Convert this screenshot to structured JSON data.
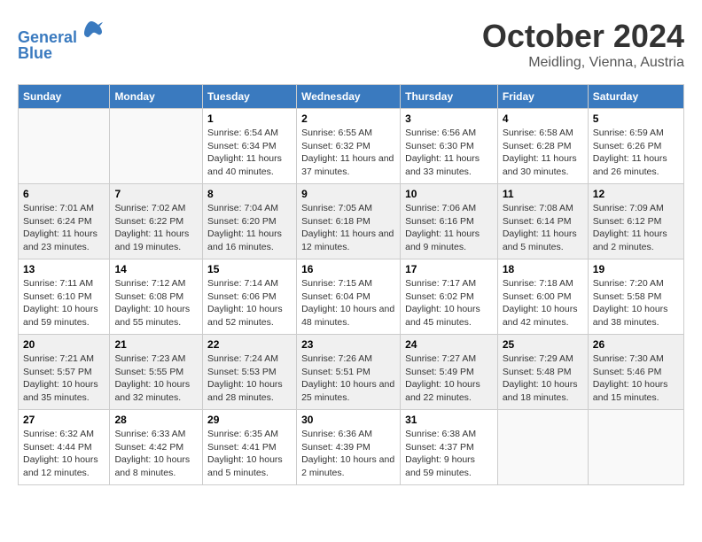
{
  "header": {
    "logo_line1": "General",
    "logo_line2": "Blue",
    "month": "October 2024",
    "location": "Meidling, Vienna, Austria"
  },
  "weekdays": [
    "Sunday",
    "Monday",
    "Tuesday",
    "Wednesday",
    "Thursday",
    "Friday",
    "Saturday"
  ],
  "weeks": [
    [
      {
        "day": "",
        "info": ""
      },
      {
        "day": "",
        "info": ""
      },
      {
        "day": "1",
        "info": "Sunrise: 6:54 AM\nSunset: 6:34 PM\nDaylight: 11 hours and 40 minutes."
      },
      {
        "day": "2",
        "info": "Sunrise: 6:55 AM\nSunset: 6:32 PM\nDaylight: 11 hours and 37 minutes."
      },
      {
        "day": "3",
        "info": "Sunrise: 6:56 AM\nSunset: 6:30 PM\nDaylight: 11 hours and 33 minutes."
      },
      {
        "day": "4",
        "info": "Sunrise: 6:58 AM\nSunset: 6:28 PM\nDaylight: 11 hours and 30 minutes."
      },
      {
        "day": "5",
        "info": "Sunrise: 6:59 AM\nSunset: 6:26 PM\nDaylight: 11 hours and 26 minutes."
      }
    ],
    [
      {
        "day": "6",
        "info": "Sunrise: 7:01 AM\nSunset: 6:24 PM\nDaylight: 11 hours and 23 minutes."
      },
      {
        "day": "7",
        "info": "Sunrise: 7:02 AM\nSunset: 6:22 PM\nDaylight: 11 hours and 19 minutes."
      },
      {
        "day": "8",
        "info": "Sunrise: 7:04 AM\nSunset: 6:20 PM\nDaylight: 11 hours and 16 minutes."
      },
      {
        "day": "9",
        "info": "Sunrise: 7:05 AM\nSunset: 6:18 PM\nDaylight: 11 hours and 12 minutes."
      },
      {
        "day": "10",
        "info": "Sunrise: 7:06 AM\nSunset: 6:16 PM\nDaylight: 11 hours and 9 minutes."
      },
      {
        "day": "11",
        "info": "Sunrise: 7:08 AM\nSunset: 6:14 PM\nDaylight: 11 hours and 5 minutes."
      },
      {
        "day": "12",
        "info": "Sunrise: 7:09 AM\nSunset: 6:12 PM\nDaylight: 11 hours and 2 minutes."
      }
    ],
    [
      {
        "day": "13",
        "info": "Sunrise: 7:11 AM\nSunset: 6:10 PM\nDaylight: 10 hours and 59 minutes."
      },
      {
        "day": "14",
        "info": "Sunrise: 7:12 AM\nSunset: 6:08 PM\nDaylight: 10 hours and 55 minutes."
      },
      {
        "day": "15",
        "info": "Sunrise: 7:14 AM\nSunset: 6:06 PM\nDaylight: 10 hours and 52 minutes."
      },
      {
        "day": "16",
        "info": "Sunrise: 7:15 AM\nSunset: 6:04 PM\nDaylight: 10 hours and 48 minutes."
      },
      {
        "day": "17",
        "info": "Sunrise: 7:17 AM\nSunset: 6:02 PM\nDaylight: 10 hours and 45 minutes."
      },
      {
        "day": "18",
        "info": "Sunrise: 7:18 AM\nSunset: 6:00 PM\nDaylight: 10 hours and 42 minutes."
      },
      {
        "day": "19",
        "info": "Sunrise: 7:20 AM\nSunset: 5:58 PM\nDaylight: 10 hours and 38 minutes."
      }
    ],
    [
      {
        "day": "20",
        "info": "Sunrise: 7:21 AM\nSunset: 5:57 PM\nDaylight: 10 hours and 35 minutes."
      },
      {
        "day": "21",
        "info": "Sunrise: 7:23 AM\nSunset: 5:55 PM\nDaylight: 10 hours and 32 minutes."
      },
      {
        "day": "22",
        "info": "Sunrise: 7:24 AM\nSunset: 5:53 PM\nDaylight: 10 hours and 28 minutes."
      },
      {
        "day": "23",
        "info": "Sunrise: 7:26 AM\nSunset: 5:51 PM\nDaylight: 10 hours and 25 minutes."
      },
      {
        "day": "24",
        "info": "Sunrise: 7:27 AM\nSunset: 5:49 PM\nDaylight: 10 hours and 22 minutes."
      },
      {
        "day": "25",
        "info": "Sunrise: 7:29 AM\nSunset: 5:48 PM\nDaylight: 10 hours and 18 minutes."
      },
      {
        "day": "26",
        "info": "Sunrise: 7:30 AM\nSunset: 5:46 PM\nDaylight: 10 hours and 15 minutes."
      }
    ],
    [
      {
        "day": "27",
        "info": "Sunrise: 6:32 AM\nSunset: 4:44 PM\nDaylight: 10 hours and 12 minutes."
      },
      {
        "day": "28",
        "info": "Sunrise: 6:33 AM\nSunset: 4:42 PM\nDaylight: 10 hours and 8 minutes."
      },
      {
        "day": "29",
        "info": "Sunrise: 6:35 AM\nSunset: 4:41 PM\nDaylight: 10 hours and 5 minutes."
      },
      {
        "day": "30",
        "info": "Sunrise: 6:36 AM\nSunset: 4:39 PM\nDaylight: 10 hours and 2 minutes."
      },
      {
        "day": "31",
        "info": "Sunrise: 6:38 AM\nSunset: 4:37 PM\nDaylight: 9 hours and 59 minutes."
      },
      {
        "day": "",
        "info": ""
      },
      {
        "day": "",
        "info": ""
      }
    ]
  ]
}
